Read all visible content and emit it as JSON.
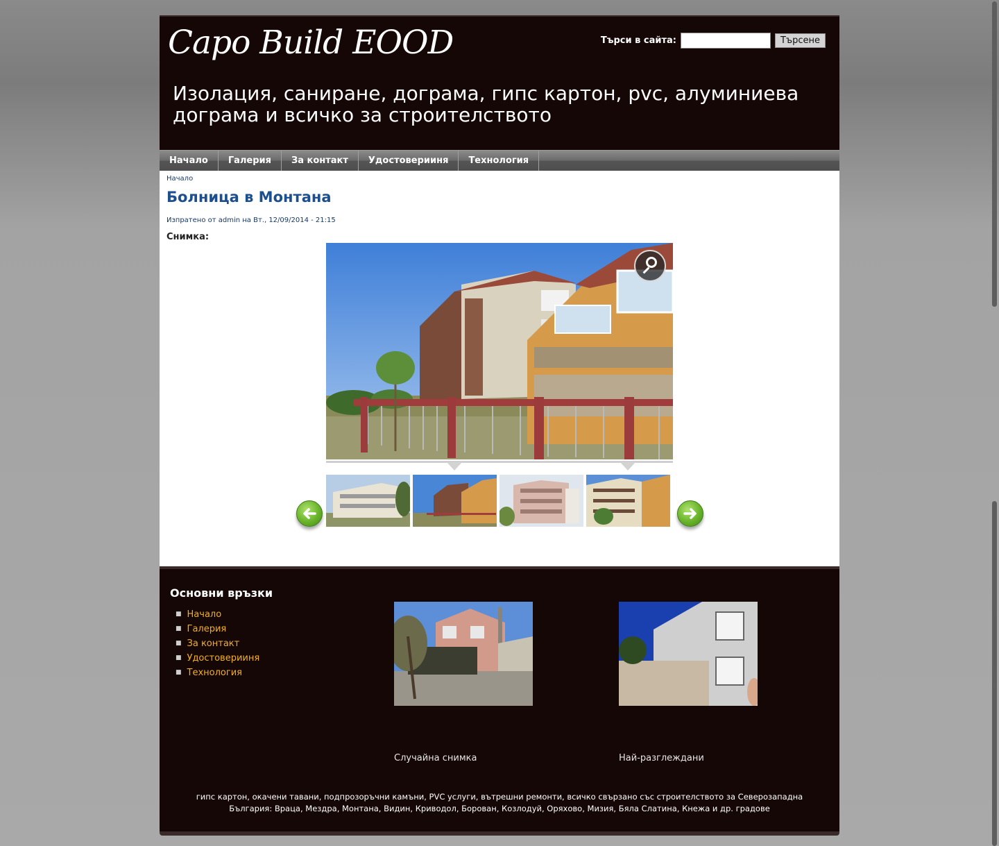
{
  "site": {
    "logo_text": "Capo Build  EOOD",
    "slogan": "Изолация, саниране, дограма, гипс картон, pvc, алуминиева дограма и всичко за строителството"
  },
  "search": {
    "label": "Търси в сайта:",
    "value": "",
    "button_label": "Търсене"
  },
  "nav": {
    "items": [
      "Начало",
      "Галерия",
      "За контакт",
      "Удостоверииня",
      "Технология"
    ]
  },
  "content": {
    "breadcrumb": "Начало",
    "title": "Болница в Монтана",
    "submitted": "Изпратено от admin на Вт., 12/09/2014 - 21:15",
    "field_label": "Снимка:"
  },
  "footer": {
    "block_title": "Основни връзки",
    "links": [
      "Начало",
      "Галерия",
      "За контакт",
      "Удостоверииня",
      "Технология"
    ],
    "random_photo_caption": "Случайна снимка",
    "most_viewed_caption": "Най-разглеждани",
    "text": "гипс картон, окачени тавани, подпрозоръчни камъни, PVC услуги, вътрешни ремонти, всичко свързано със строителството за Северозападна България: Враца, Мездра, Монтана, Видин, Криводол, Борован, Козлодуй, Оряхово, Мизия, Бяла Слатина, Кнежа и др. градове"
  },
  "colors": {
    "header_bg": "#160707",
    "title_blue": "#1d4e8e",
    "link_gold": "#f2b01e",
    "arrow_green": "#69b32a"
  },
  "icons": {
    "zoom": "magnifier-icon",
    "prev": "arrow-left-icon",
    "next": "arrow-right-icon"
  }
}
